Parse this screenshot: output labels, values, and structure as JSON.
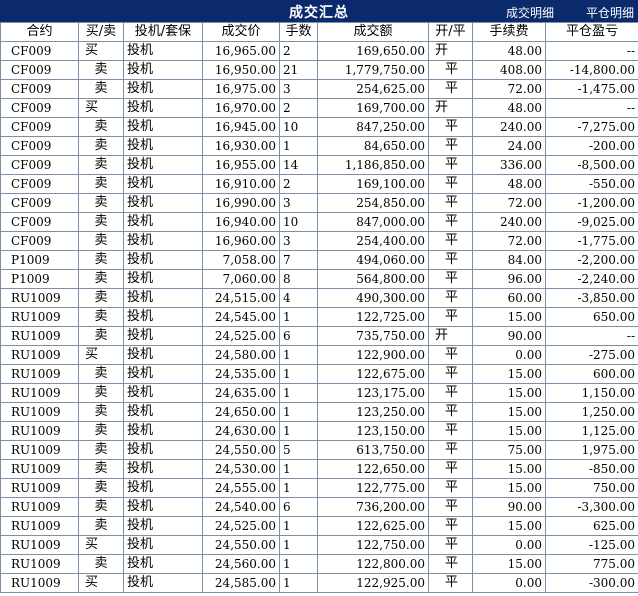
{
  "header": {
    "title": "成交汇总",
    "tab_detail": "成交明细",
    "tab_positions": "平仓明细"
  },
  "columns": [
    "合约",
    "买/卖",
    "投机/套保",
    "成交价",
    "手数",
    "成交额",
    "开/平",
    "手续费",
    "平仓盈亏"
  ],
  "rows": [
    [
      "CF009",
      "买",
      "投机",
      "16,965.00",
      "2",
      "169,650.00",
      "开",
      "48.00",
      "--"
    ],
    [
      "CF009",
      "卖",
      "投机",
      "16,950.00",
      "21",
      "1,779,750.00",
      "平",
      "408.00",
      "-14,800.00"
    ],
    [
      "CF009",
      "卖",
      "投机",
      "16,975.00",
      "3",
      "254,625.00",
      "平",
      "72.00",
      "-1,475.00"
    ],
    [
      "CF009",
      "买",
      "投机",
      "16,970.00",
      "2",
      "169,700.00",
      "开",
      "48.00",
      "--"
    ],
    [
      "CF009",
      "卖",
      "投机",
      "16,945.00",
      "10",
      "847,250.00",
      "平",
      "240.00",
      "-7,275.00"
    ],
    [
      "CF009",
      "卖",
      "投机",
      "16,930.00",
      "1",
      "84,650.00",
      "平",
      "24.00",
      "-200.00"
    ],
    [
      "CF009",
      "卖",
      "投机",
      "16,955.00",
      "14",
      "1,186,850.00",
      "平",
      "336.00",
      "-8,500.00"
    ],
    [
      "CF009",
      "卖",
      "投机",
      "16,910.00",
      "2",
      "169,100.00",
      "平",
      "48.00",
      "-550.00"
    ],
    [
      "CF009",
      "卖",
      "投机",
      "16,990.00",
      "3",
      "254,850.00",
      "平",
      "72.00",
      "-1,200.00"
    ],
    [
      "CF009",
      "卖",
      "投机",
      "16,940.00",
      "10",
      "847,000.00",
      "平",
      "240.00",
      "-9,025.00"
    ],
    [
      "CF009",
      "卖",
      "投机",
      "16,960.00",
      "3",
      "254,400.00",
      "平",
      "72.00",
      "-1,775.00"
    ],
    [
      "P1009",
      "卖",
      "投机",
      "7,058.00",
      "7",
      "494,060.00",
      "平",
      "84.00",
      "-2,200.00"
    ],
    [
      "P1009",
      "卖",
      "投机",
      "7,060.00",
      "8",
      "564,800.00",
      "平",
      "96.00",
      "-2,240.00"
    ],
    [
      "RU1009",
      "卖",
      "投机",
      "24,515.00",
      "4",
      "490,300.00",
      "平",
      "60.00",
      "-3,850.00"
    ],
    [
      "RU1009",
      "卖",
      "投机",
      "24,545.00",
      "1",
      "122,725.00",
      "平",
      "15.00",
      "650.00"
    ],
    [
      "RU1009",
      "卖",
      "投机",
      "24,525.00",
      "6",
      "735,750.00",
      "开",
      "90.00",
      "--"
    ],
    [
      "RU1009",
      "买",
      "投机",
      "24,580.00",
      "1",
      "122,900.00",
      "平",
      "0.00",
      "-275.00"
    ],
    [
      "RU1009",
      "卖",
      "投机",
      "24,535.00",
      "1",
      "122,675.00",
      "平",
      "15.00",
      "600.00"
    ],
    [
      "RU1009",
      "卖",
      "投机",
      "24,635.00",
      "1",
      "123,175.00",
      "平",
      "15.00",
      "1,150.00"
    ],
    [
      "RU1009",
      "卖",
      "投机",
      "24,650.00",
      "1",
      "123,250.00",
      "平",
      "15.00",
      "1,250.00"
    ],
    [
      "RU1009",
      "卖",
      "投机",
      "24,630.00",
      "1",
      "123,150.00",
      "平",
      "15.00",
      "1,125.00"
    ],
    [
      "RU1009",
      "卖",
      "投机",
      "24,550.00",
      "5",
      "613,750.00",
      "平",
      "75.00",
      "1,975.00"
    ],
    [
      "RU1009",
      "卖",
      "投机",
      "24,530.00",
      "1",
      "122,650.00",
      "平",
      "15.00",
      "-850.00"
    ],
    [
      "RU1009",
      "卖",
      "投机",
      "24,555.00",
      "1",
      "122,775.00",
      "平",
      "15.00",
      "750.00"
    ],
    [
      "RU1009",
      "卖",
      "投机",
      "24,540.00",
      "6",
      "736,200.00",
      "平",
      "90.00",
      "-3,300.00"
    ],
    [
      "RU1009",
      "卖",
      "投机",
      "24,525.00",
      "1",
      "122,625.00",
      "平",
      "15.00",
      "625.00"
    ],
    [
      "RU1009",
      "买",
      "投机",
      "24,550.00",
      "1",
      "122,750.00",
      "平",
      "0.00",
      "-125.00"
    ],
    [
      "RU1009",
      "卖",
      "投机",
      "24,560.00",
      "1",
      "122,800.00",
      "平",
      "15.00",
      "775.00"
    ],
    [
      "RU1009",
      "买",
      "投机",
      "24,585.00",
      "1",
      "122,925.00",
      "平",
      "0.00",
      "-300.00"
    ]
  ],
  "colors": {
    "titlebar": "#0a2a6b",
    "title_text": "#ffffff",
    "grid_border": "#7e8fa8"
  }
}
